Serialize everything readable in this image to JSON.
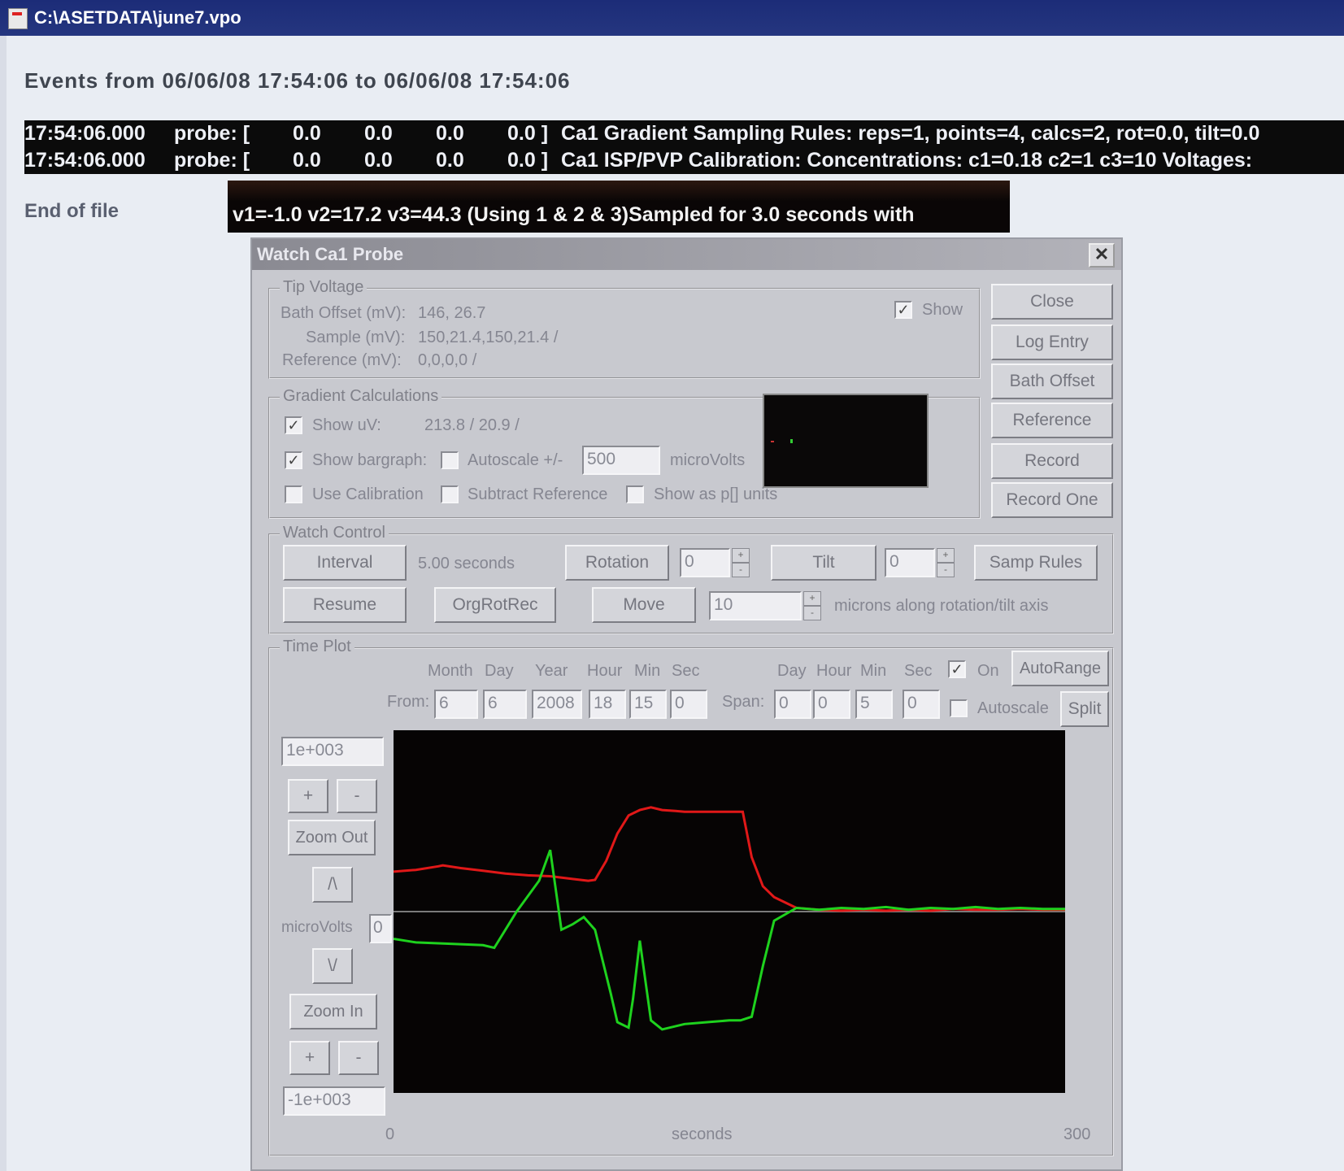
{
  "window": {
    "title": "C:\\ASETDATA\\june7.vpo"
  },
  "events_header": "Events from 06/06/08 17:54:06 to 06/06/08 17:54:06",
  "log_rows": [
    {
      "time": "17:54:06.000",
      "probe": "probe: [",
      "v1": "0.0",
      "v2": "0.0",
      "v3": "0.0",
      "v4": "0.0 ]",
      "text": "Ca1 Gradient Sampling Rules:  reps=1, points=4, calcs=2, rot=0.0, tilt=0.0"
    },
    {
      "time": "17:54:06.000",
      "probe": "probe: [",
      "v1": "0.0",
      "v2": "0.0",
      "v3": "0.0",
      "v4": "0.0 ]",
      "text": "Ca1 ISP/PVP Calibration:  Concentrations: c1=0.18  c2=1  c3=10  Voltages:"
    }
  ],
  "log_overflow": "v1=-1.0  v2=17.2  v3=44.3 (Using 1 & 2 & 3)Sampled for 3.0 seconds with",
  "end_of_file": "End of file",
  "dialog": {
    "title": "Watch Ca1 Probe",
    "close_glyph": "✕",
    "tip_voltage": {
      "label": "Tip Voltage",
      "bath_offset_label": "Bath Offset (mV):",
      "bath_offset_value": "146, 26.7",
      "sample_label": "Sample (mV):",
      "sample_value": "150,21.4,150,21.4 /",
      "reference_label": "Reference (mV):",
      "reference_value": "0,0,0,0 /",
      "show_label": "Show",
      "show_checked": true
    },
    "side_buttons": [
      "Close",
      "Log Entry",
      "Bath Offset",
      "Reference",
      "Record",
      "Record One"
    ],
    "gradient": {
      "label": "Gradient Calculations",
      "show_uv_label": "Show uV:",
      "show_uv_checked": true,
      "uv_value": "213.8 / 20.9 /",
      "show_bargraph_label": "Show bargraph:",
      "show_bargraph_checked": true,
      "autoscale_label": "Autoscale +/-",
      "autoscale_checked": false,
      "autoscale_value": "500",
      "microvolts_label": "microVolts",
      "use_calibration_label": "Use Calibration",
      "use_calibration_checked": false,
      "subtract_reference_label": "Subtract Reference",
      "subtract_reference_checked": false,
      "show_pl_units_label": "Show as p[] units",
      "show_pl_units_checked": false
    },
    "watch_control": {
      "label": "Watch Control",
      "interval_button": "Interval",
      "interval_value": "5.00 seconds",
      "rotation_button": "Rotation",
      "rotation_value": "0",
      "tilt_button": "Tilt",
      "tilt_value": "0",
      "samp_rules_button": "Samp Rules",
      "resume_button": "Resume",
      "orgrotrec_button": "OrgRotRec",
      "move_button": "Move",
      "move_value": "10",
      "move_units": "microns along rotation/tilt axis"
    },
    "time_plot": {
      "label": "Time Plot",
      "col_month": "Month",
      "col_day": "Day",
      "col_year": "Year",
      "col_hour": "Hour",
      "col_min": "Min",
      "col_sec": "Sec",
      "from_label": "From:",
      "from_month": "6",
      "from_day": "6",
      "from_year": "2008",
      "from_hour": "18",
      "from_min": "15",
      "from_sec": "0",
      "span_col_day": "Day",
      "span_col_hour": "Hour",
      "span_col_min": "Min",
      "span_col_sec": "Sec",
      "span_label": "Span:",
      "span_day": "0",
      "span_hour": "0",
      "span_min": "5",
      "span_sec": "0",
      "on_label": "On",
      "on_checked": true,
      "autorange_button": "AutoRange",
      "autoscale_label": "Autoscale",
      "autoscale_checked": false,
      "split_button": "Split",
      "y_max": "1e+003",
      "y_min": "-1e+003",
      "plus": "+",
      "minus": "-",
      "zoom_out": "Zoom Out",
      "zoom_in": "Zoom In",
      "up": "/\\",
      "down": "\\/",
      "y_label": "microVolts",
      "y_zero_field": "0",
      "x_min_label": "0",
      "x_max_label": "300",
      "x_axis_label": "seconds"
    }
  },
  "chart_data": {
    "type": "line",
    "xlabel": "seconds",
    "ylabel": "microVolts",
    "xlim": [
      0,
      300
    ],
    "ylim": [
      -1000,
      1000
    ],
    "series": [
      {
        "color": "#e01818",
        "x": [
          0,
          10,
          20,
          22,
          30,
          40,
          50,
          60,
          70,
          80,
          87,
          90,
          95,
          100,
          105,
          110,
          115,
          120,
          126,
          130,
          140,
          150,
          156,
          160,
          165,
          170,
          180,
          190,
          200,
          210,
          220,
          230,
          240,
          250,
          260,
          270,
          280,
          290,
          300
        ],
        "y": [
          220,
          230,
          250,
          255,
          240,
          225,
          210,
          200,
          195,
          180,
          170,
          175,
          280,
          430,
          530,
          560,
          575,
          560,
          555,
          550,
          550,
          550,
          550,
          300,
          140,
          80,
          20,
          10,
          5,
          10,
          5,
          10,
          5,
          15,
          10,
          10,
          15,
          10,
          10
        ]
      },
      {
        "color": "#1ed21e",
        "x": [
          0,
          5,
          10,
          20,
          30,
          40,
          45,
          55,
          65,
          70,
          75,
          80,
          85,
          90,
          97,
          100,
          105,
          107,
          110,
          115,
          120,
          130,
          140,
          150,
          155,
          160,
          165,
          170,
          180,
          190,
          200,
          210,
          220,
          230,
          240,
          250,
          260,
          270,
          280,
          290,
          300
        ],
        "y": [
          -150,
          -160,
          -170,
          -175,
          -180,
          -185,
          -200,
          0,
          170,
          340,
          -100,
          -70,
          -30,
          -100,
          -450,
          -610,
          -640,
          -480,
          -160,
          -600,
          -650,
          -620,
          -610,
          -600,
          -600,
          -580,
          -300,
          -50,
          20,
          10,
          20,
          15,
          25,
          10,
          20,
          15,
          25,
          15,
          20,
          15,
          15
        ]
      }
    ]
  }
}
